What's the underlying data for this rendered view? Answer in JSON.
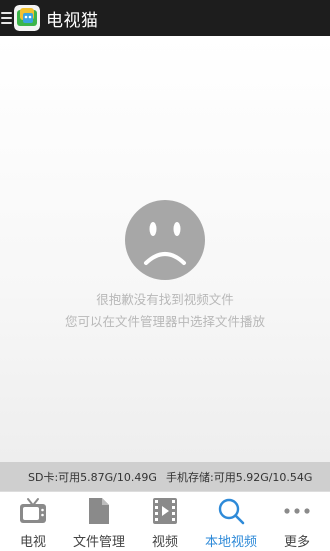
{
  "app": {
    "title": "电视猫"
  },
  "empty_state": {
    "line1": "很抱歉没有找到视频文件",
    "line2": "您可以在文件管理器中选择文件播放"
  },
  "storage": {
    "sd": "SD卡:可用5.87G/10.49G",
    "phone": "手机存储:可用5.92G/10.54G"
  },
  "tabs": [
    {
      "label": "电视",
      "icon": "tv-icon"
    },
    {
      "label": "文件管理",
      "icon": "file-icon"
    },
    {
      "label": "视频",
      "icon": "film-icon"
    },
    {
      "label": "本地视频",
      "icon": "search-icon",
      "active": true
    },
    {
      "label": "更多",
      "icon": "more-icon"
    }
  ],
  "colors": {
    "appbar": "#1d1d1d",
    "accent": "#2e8ad8",
    "storage_bar": "#cfcfcf"
  }
}
